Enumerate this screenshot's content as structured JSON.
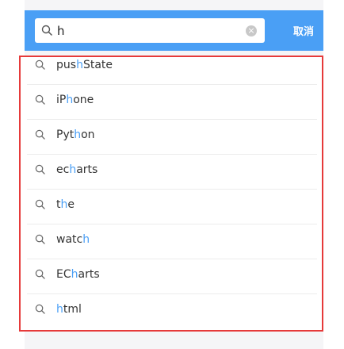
{
  "colors": {
    "accent": "#4a9ff5",
    "highlight": "#4a9ff5",
    "panel_border": "#e63a3a",
    "background": "#f5f5f7"
  },
  "search": {
    "value": "h",
    "icon": "search-icon",
    "clear_icon": "clear-icon",
    "cancel_label": "取消"
  },
  "suggestions": [
    {
      "before": "pus",
      "match": "h",
      "after": "State"
    },
    {
      "before": "iP",
      "match": "h",
      "after": "one"
    },
    {
      "before": "Pyt",
      "match": "h",
      "after": "on"
    },
    {
      "before": "ec",
      "match": "h",
      "after": "arts"
    },
    {
      "before": "t",
      "match": "h",
      "after": "e"
    },
    {
      "before": "watc",
      "match": "h",
      "after": ""
    },
    {
      "before": "EC",
      "match": "h",
      "after": "arts"
    },
    {
      "before": "",
      "match": "h",
      "after": "tml"
    }
  ]
}
